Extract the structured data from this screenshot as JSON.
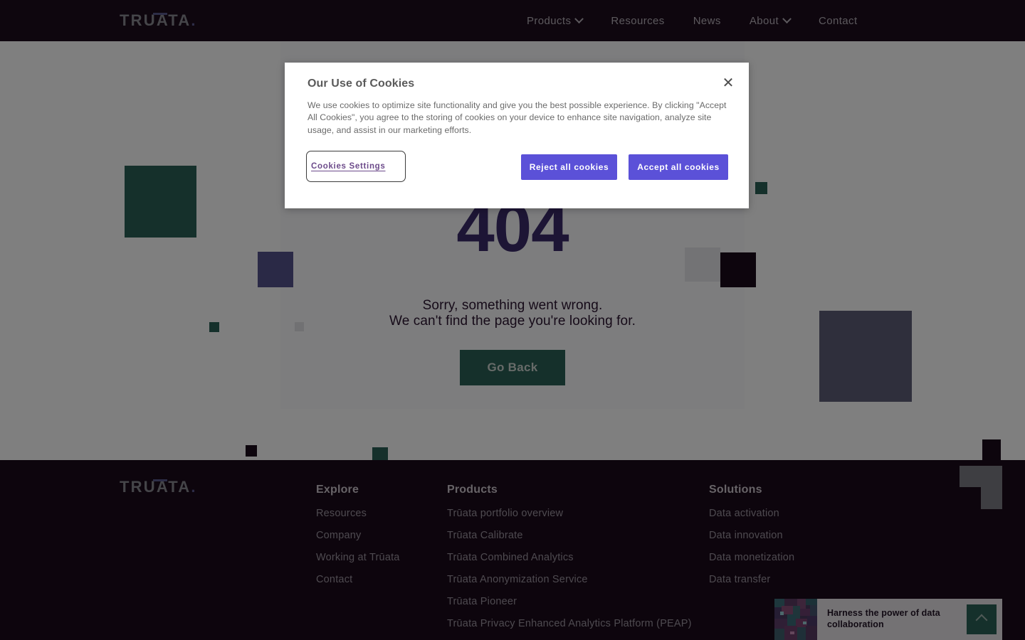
{
  "header": {
    "logo_text": "TRUATA",
    "logo_dot": ".",
    "nav": [
      {
        "label": "Products",
        "has_dropdown": true
      },
      {
        "label": "Resources",
        "has_dropdown": false
      },
      {
        "label": "News",
        "has_dropdown": false
      },
      {
        "label": "About",
        "has_dropdown": true
      },
      {
        "label": "Contact",
        "has_dropdown": false
      }
    ]
  },
  "hero": {
    "code": "404",
    "line1": "Sorry, something went wrong.",
    "line2": "We can't find the page you're looking for.",
    "button_label": "Go Back",
    "accent_green": "#2b6157",
    "accent_purple": "#3b2a6b",
    "accent_indigo": "#5b5a8e",
    "accent_dark": "#1a0b1a"
  },
  "cookie_modal": {
    "title": "Our Use of Cookies",
    "body": "We use cookies to optimize site functionality and give you the best possible experience. By clicking \"Accept All Cookies\", you agree to the storing of cookies on your device to enhance site navigation, analyze site usage, and assist in our marketing efforts.",
    "settings_label": "Cookies Settings",
    "reject_label": "Reject all cookies",
    "accept_label": "Accept all cookies",
    "close_glyph": "✕",
    "button_color": "#5b51d8",
    "link_color": "#6c4a8a"
  },
  "footer": {
    "logo_text": "TRUATA",
    "logo_dot": ".",
    "columns": [
      {
        "heading": "Explore",
        "links": [
          "Resources",
          "Company",
          "Working at Trūata",
          "Contact"
        ]
      },
      {
        "heading": "Products",
        "links": [
          "Trūata portfolio overview",
          "Trūata Calibrate",
          "Trūata Combined Analytics",
          "Trūata Anonymization Service",
          "Trūata Pioneer",
          "Trūata Privacy Enhanced Analytics Platform (PEAP)"
        ]
      },
      {
        "heading": "Solutions",
        "links": [
          "Data activation",
          "Data innovation",
          "Data monetization",
          "Data transfer"
        ]
      }
    ]
  },
  "promo": {
    "title": "Harness the power of data collaboration",
    "toggle_icon": "chevron-up-icon",
    "toggle_color": "#2b6157"
  }
}
